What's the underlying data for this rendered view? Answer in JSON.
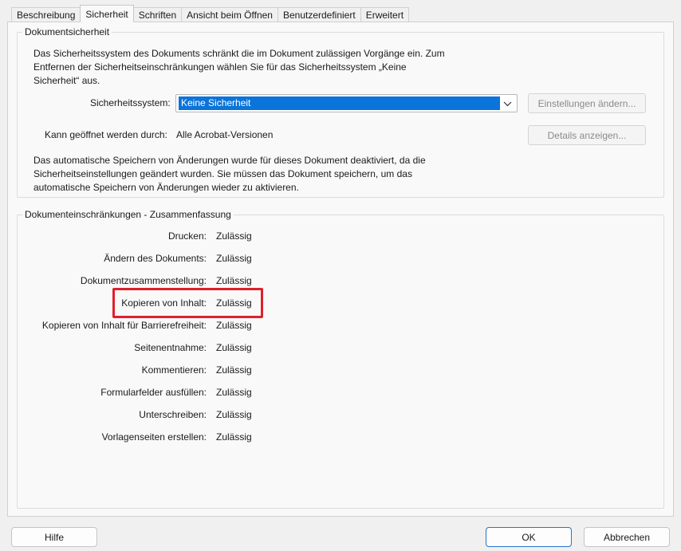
{
  "tabs": [
    {
      "label": "Beschreibung"
    },
    {
      "label": "Sicherheit",
      "active": true
    },
    {
      "label": "Schriften"
    },
    {
      "label": "Ansicht beim Öffnen"
    },
    {
      "label": "Benutzerdefiniert"
    },
    {
      "label": "Erweitert"
    }
  ],
  "security": {
    "title": "Dokumentsicherheit",
    "intro_lines": [
      "Das Sicherheitssystem des Dokuments schränkt die im Dokument zulässigen Vorgänge ein. Zum",
      "Entfernen der Sicherheitseinschränkungen wählen Sie für das Sicherheitssystem „Keine",
      "Sicherheit“ aus."
    ],
    "system_label": "Sicherheitssystem:",
    "system_value": "Keine Sicherheit",
    "settings_button": "Einstellungen ändern...",
    "openable_label": "Kann geöffnet werden durch:",
    "openable_value": "Alle Acrobat-Versionen",
    "details_button": "Details anzeigen...",
    "autosave_lines": [
      "Das automatische Speichern von Änderungen wurde für dieses Dokument deaktiviert, da die",
      "Sicherheitseinstellungen geändert wurden. Sie müssen das Dokument speichern, um das",
      "automatische Speichern von Änderungen wieder zu aktivieren."
    ]
  },
  "restrictions": {
    "title": "Dokumenteinschränkungen - Zusammenfassung",
    "rows": [
      {
        "label": "Drucken:",
        "value": "Zulässig"
      },
      {
        "label": "Ändern des Dokuments:",
        "value": "Zulässig"
      },
      {
        "label": "Dokumentzusammenstellung:",
        "value": "Zulässig"
      },
      {
        "label": "Kopieren von Inhalt:",
        "value": "Zulässig"
      },
      {
        "label": "Kopieren von Inhalt für Barrierefreiheit:",
        "value": "Zulässig"
      },
      {
        "label": "Seitenentnahme:",
        "value": "Zulässig"
      },
      {
        "label": "Kommentieren:",
        "value": "Zulässig"
      },
      {
        "label": "Formularfelder ausfüllen:",
        "value": "Zulässig"
      },
      {
        "label": "Unterschreiben:",
        "value": "Zulässig"
      },
      {
        "label": "Vorlagenseiten erstellen:",
        "value": "Zulässig"
      }
    ]
  },
  "footer": {
    "help": "Hilfe",
    "ok": "OK",
    "cancel": "Abbrechen"
  },
  "colors": {
    "selection": "#0a74da",
    "highlight": "#e0202a"
  },
  "icons": {
    "combo_arrow": "chevron-down-icon"
  }
}
